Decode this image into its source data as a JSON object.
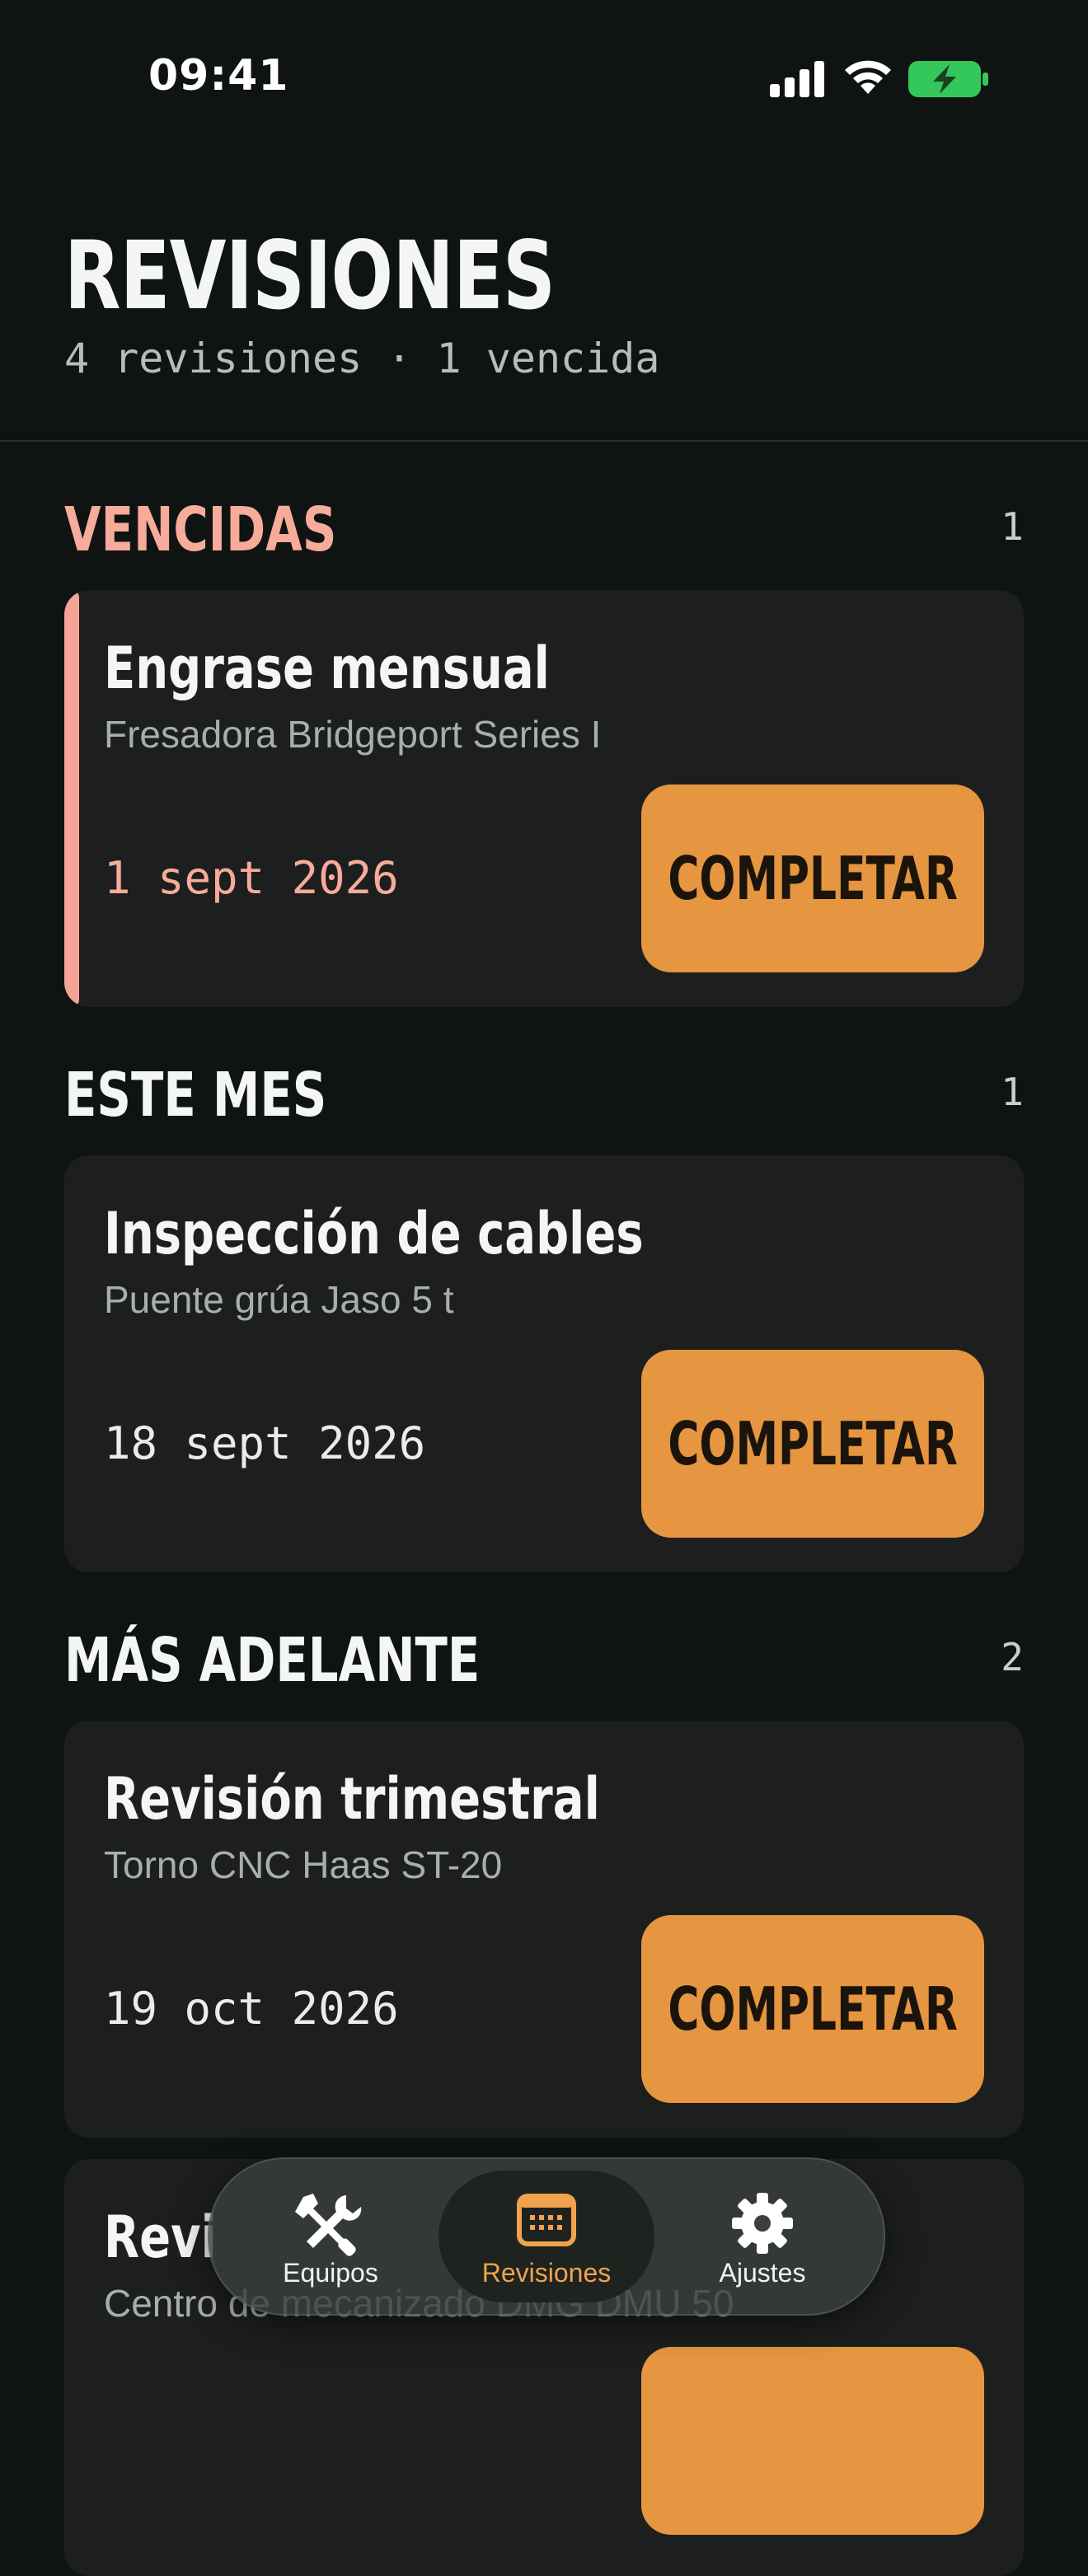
{
  "status_bar": {
    "time": "09:41"
  },
  "header": {
    "title": "REVISIONES",
    "subtitle": "4 revisiones · 1 vencida"
  },
  "sections": [
    {
      "title": "VENCIDAS",
      "count": "1",
      "items": [
        {
          "title": "Engrase mensual",
          "equipment": "Fresadora Bridgeport Series I",
          "date": "1 sept 2026",
          "action": "COMPLETAR"
        }
      ]
    },
    {
      "title": "ESTE MES",
      "count": "1",
      "items": [
        {
          "title": "Inspección de cables",
          "equipment": "Puente grúa Jaso 5 t",
          "date": "18 sept 2026",
          "action": "COMPLETAR"
        }
      ]
    },
    {
      "title": "MÁS ADELANTE",
      "count": "2",
      "items": [
        {
          "title": "Revisión trimestral",
          "equipment": "Torno CNC Haas ST-20",
          "date": "19 oct 2026",
          "action": "COMPLETAR"
        },
        {
          "title": "Revi",
          "equipment": "Centro de mecanizado DMG DMU 50",
          "date": "",
          "action": ""
        }
      ]
    }
  ],
  "tab_bar": {
    "tabs": [
      {
        "label": "Equipos",
        "icon": "tools-icon"
      },
      {
        "label": "Revisiones",
        "icon": "calendar-icon"
      },
      {
        "label": "Ajustes",
        "icon": "gear-icon"
      }
    ],
    "active": "Revisiones"
  },
  "colors": {
    "background": "#0f1412",
    "card": "#1c1f1d",
    "accent": "#e69540",
    "overdue": "#f7ab9b",
    "battery": "#34c759"
  }
}
